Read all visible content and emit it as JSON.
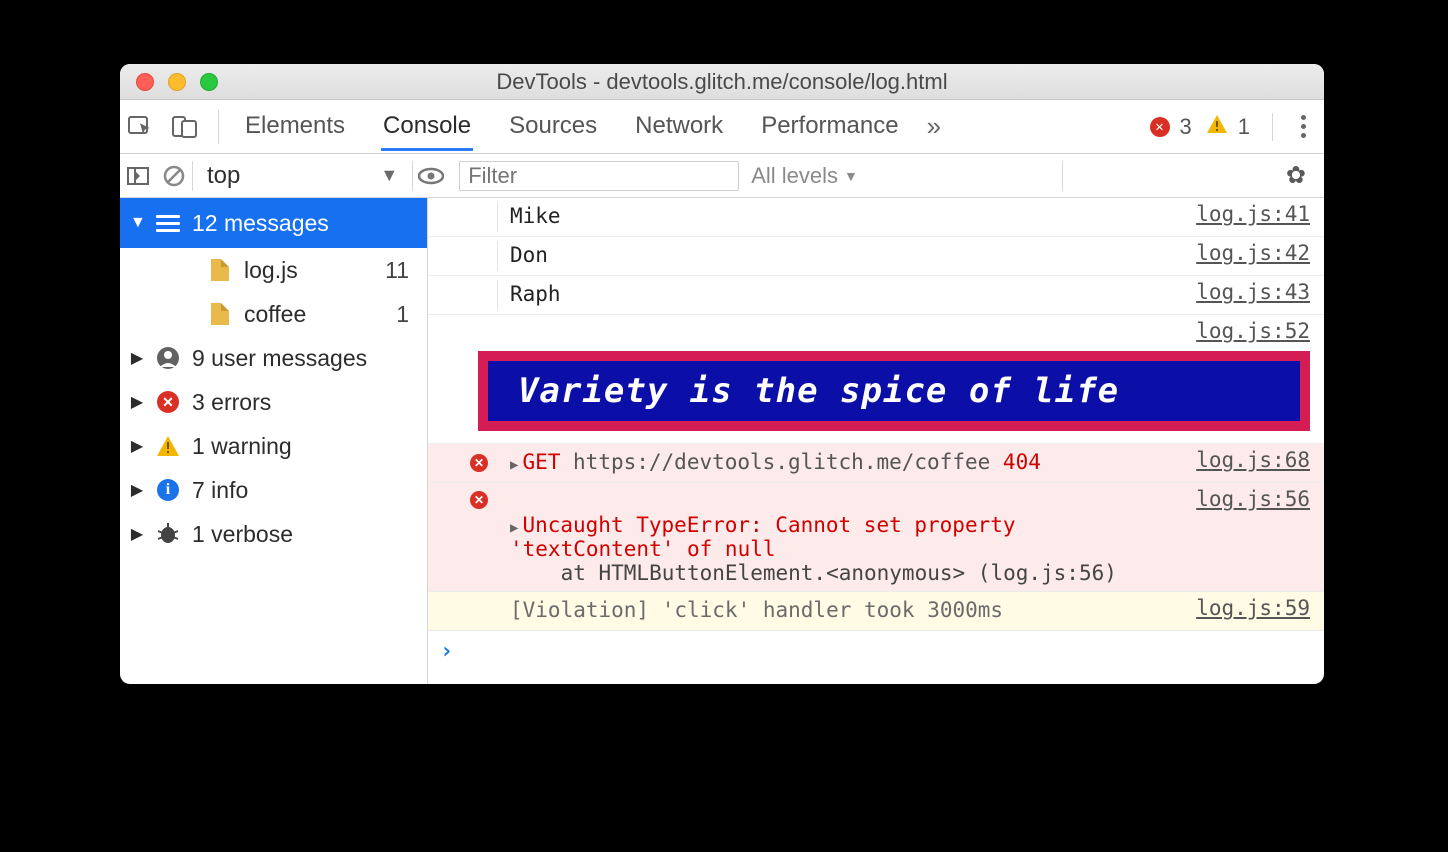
{
  "window_title": "DevTools - devtools.glitch.me/console/log.html",
  "tabs": [
    "Elements",
    "Console",
    "Sources",
    "Network",
    "Performance"
  ],
  "active_tab": "Console",
  "toolbar_counts": {
    "errors": "3",
    "warnings": "1"
  },
  "filterbar": {
    "context": "top",
    "filter_placeholder": "Filter",
    "levels": "All levels"
  },
  "sidebar": {
    "header": "12 messages",
    "files": [
      {
        "name": "log.js",
        "count": "11"
      },
      {
        "name": "coffee",
        "count": "1"
      }
    ],
    "groups": [
      {
        "label": "9 user messages",
        "icon": "user"
      },
      {
        "label": "3 errors",
        "icon": "error"
      },
      {
        "label": "1 warning",
        "icon": "warn"
      },
      {
        "label": "7 info",
        "icon": "info"
      },
      {
        "label": "1 verbose",
        "icon": "bug"
      }
    ]
  },
  "console": {
    "rows": [
      {
        "text": "Mike",
        "src": "log.js:41"
      },
      {
        "text": "Don",
        "src": "log.js:42"
      },
      {
        "text": "Raph",
        "src": "log.js:43"
      }
    ],
    "styled_row_src": "log.js:52",
    "styled_text": "Variety is the spice of life",
    "net_error": {
      "method": "GET",
      "url": "https://devtools.glitch.me/coffee",
      "status": "404",
      "src": "log.js:68"
    },
    "type_error": {
      "line1": "Uncaught TypeError: Cannot set property",
      "line2": "'textContent' of null",
      "line3_prefix": "    at HTMLButtonElement.<anonymous> (",
      "line3_link": "log.js:56",
      "line3_suffix": ")",
      "src": "log.js:56"
    },
    "violation": {
      "text": "[Violation] 'click' handler took 3000ms",
      "src": "log.js:59"
    },
    "prompt": "›"
  }
}
